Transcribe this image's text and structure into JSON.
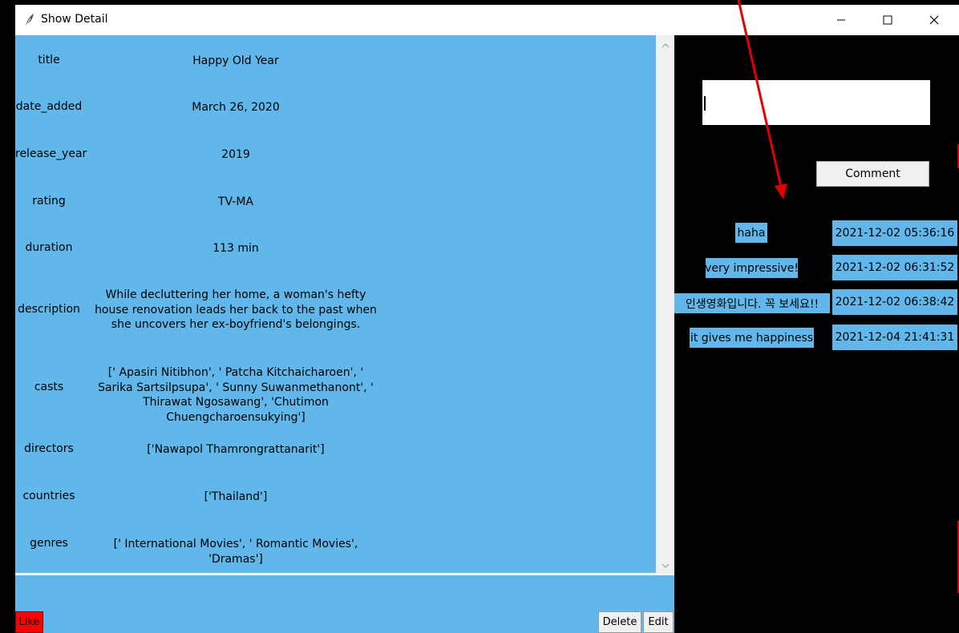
{
  "window": {
    "title": "Show Detail"
  },
  "fields": [
    {
      "label": "title",
      "value": "Happy Old Year"
    },
    {
      "label": "date_added",
      "value": "March 26, 2020"
    },
    {
      "label": "release_year",
      "value": "2019"
    },
    {
      "label": "rating",
      "value": "TV-MA"
    },
    {
      "label": "duration",
      "value": "113 min"
    },
    {
      "label": "description",
      "value": "While decluttering her home, a woman's hefty house renovation leads her back to the past when she uncovers her ex-boyfriend's belongings."
    },
    {
      "label": "casts",
      "value": "[' Apasiri Nitibhon', ' Patcha Kitchaicharoen', ' Sarika Sartsilpsupa', ' Sunny Suwanmethanont', ' Thirawat Ngosawang', 'Chutimon Chuengcharoensukying']"
    },
    {
      "label": "directors",
      "value": "['Nawapol Thamrongrattanarit']"
    },
    {
      "label": "countries",
      "value": "['Thailand']"
    },
    {
      "label": "genres",
      "value": "[' International Movies', ' Romantic Movies', 'Dramas']"
    }
  ],
  "buttons": {
    "like": "Like",
    "delete": "Delete",
    "edit": "Edit",
    "comment": "Comment"
  },
  "comment_input": {
    "value": ""
  },
  "comments": [
    {
      "text": "haha",
      "time": "2021-12-02 05:36:16"
    },
    {
      "text": "very impressive!",
      "time": "2021-12-02 06:31:52"
    },
    {
      "text": "인생영화입니다. 꼭 보세요!!",
      "time": "2021-12-02 06:38:42"
    },
    {
      "text": "it gives me happiness",
      "time": "2021-12-04 21:41:31"
    }
  ],
  "colors": {
    "panel": "#61b7ea",
    "background": "#000000",
    "like": "#ff0000",
    "annotation_arrow": "#e00000"
  },
  "icons": {
    "app": "feather-icon",
    "minimize": "minimize-icon",
    "maximize": "maximize-icon",
    "close": "close-icon"
  }
}
